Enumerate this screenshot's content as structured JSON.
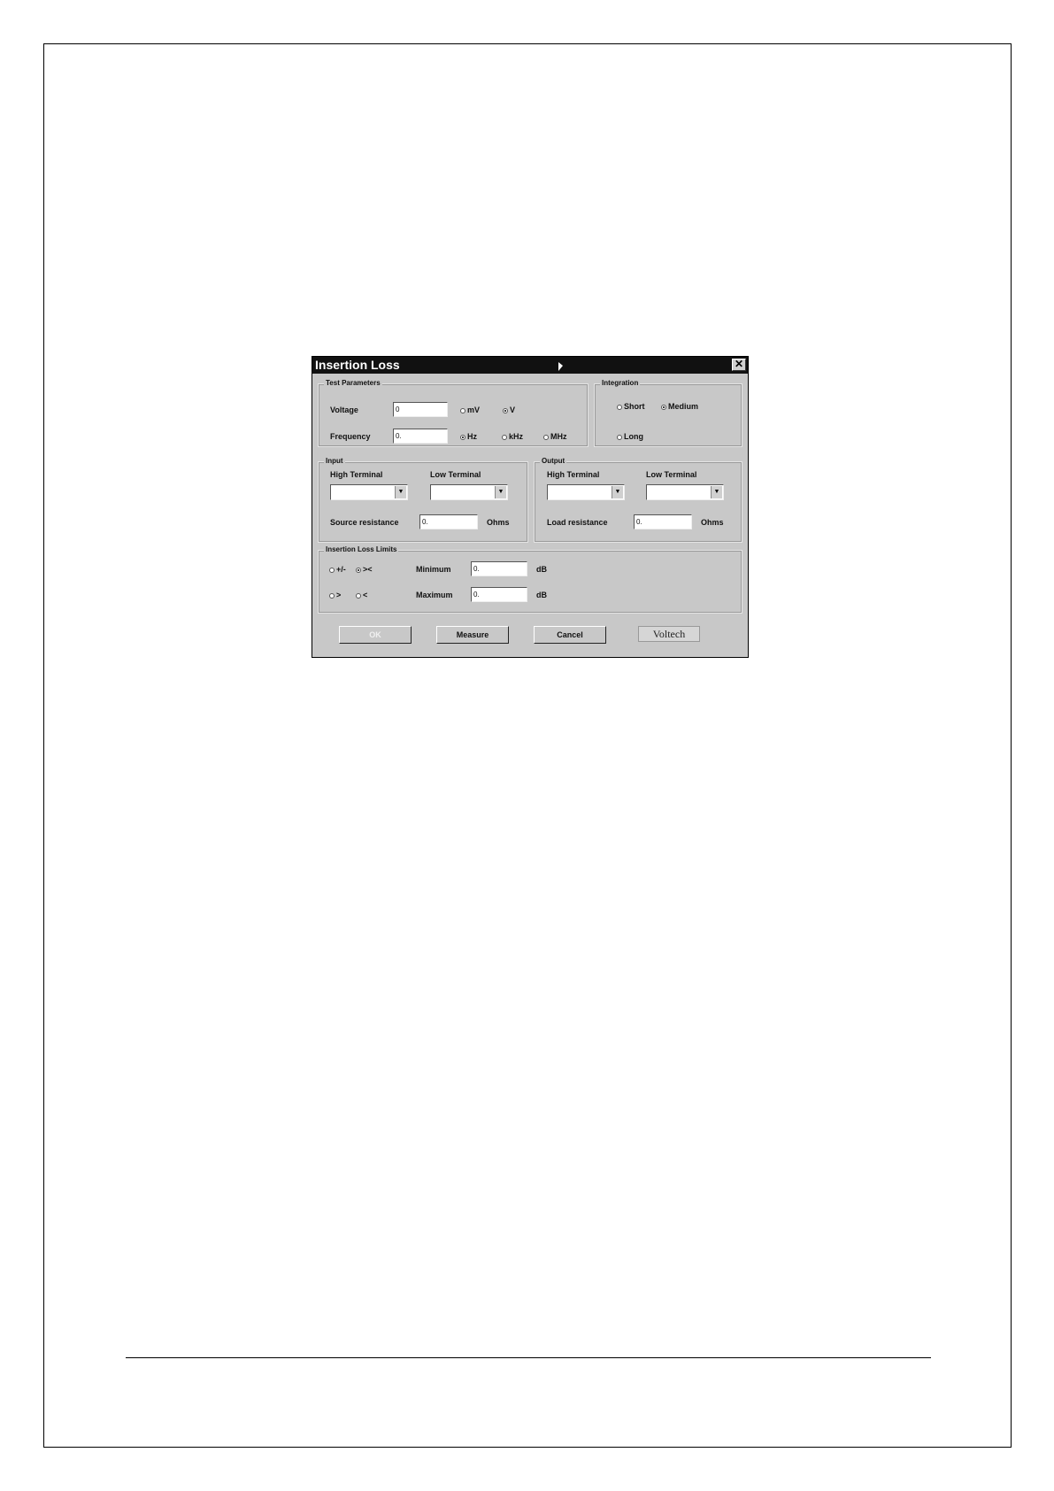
{
  "dialog": {
    "title": "Insertion Loss",
    "close_glyph": "✕",
    "test_parameters": {
      "label": "Test Parameters",
      "voltage_label": "Voltage",
      "voltage_value": "0",
      "voltage_units": [
        "mV",
        "V"
      ],
      "voltage_selected": "V",
      "frequency_label": "Frequency",
      "frequency_value": "0.",
      "frequency_units": [
        "Hz",
        "kHz",
        "MHz"
      ],
      "frequency_selected": "Hz"
    },
    "integration": {
      "label": "Integration",
      "options": [
        "Short",
        "Medium",
        "Long"
      ],
      "selected": "Medium"
    },
    "input": {
      "label": "Input",
      "high_terminal_label": "High Terminal",
      "low_terminal_label": "Low Terminal",
      "resistance_label": "Source resistance",
      "resistance_value": "0.",
      "resistance_unit": "Ohms"
    },
    "output": {
      "label": "Output",
      "high_terminal_label": "High Terminal",
      "low_terminal_label": "Low Terminal",
      "resistance_label": "Load resistance",
      "resistance_value": "0.",
      "resistance_unit": "Ohms"
    },
    "limits": {
      "label": "Insertion Loss Limits",
      "modes": [
        "+/-",
        "><",
        ">",
        "<"
      ],
      "selected": "><",
      "minimum_label": "Minimum",
      "minimum_value": "0.",
      "maximum_label": "Maximum",
      "maximum_value": "0.",
      "unit": "dB"
    },
    "buttons": {
      "ok": "OK",
      "measure": "Measure",
      "cancel": "Cancel"
    },
    "logo_text": "Voltech",
    "icons": {
      "close": "close-icon",
      "dropdown": "chevron-down-icon"
    }
  }
}
